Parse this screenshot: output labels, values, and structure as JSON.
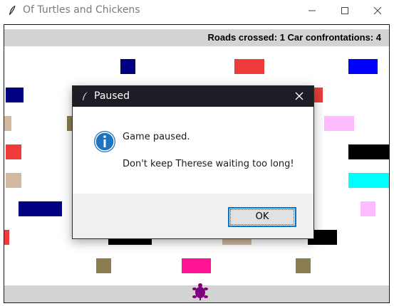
{
  "window": {
    "title": "Of Turtles and Chickens"
  },
  "game": {
    "hud": "Roads crossed: 1  Car confrontations: 4",
    "player": "turtle",
    "colors": {
      "navy": "#000080",
      "blue": "#0000ff",
      "red": "#ee3b3b",
      "tan": "#d2b9a0",
      "olive": "#8b7d50",
      "black": "#000000",
      "cyan": "#00ffff",
      "pink": "#ffbbff",
      "deep_pink": "#ff1493",
      "purple": "#800080",
      "lane_gray": "#d3d3d3"
    }
  },
  "dialog": {
    "title": "Paused",
    "line1": "Game paused.",
    "line2": "Don't keep Therese waiting too long!",
    "ok_label": "OK"
  }
}
